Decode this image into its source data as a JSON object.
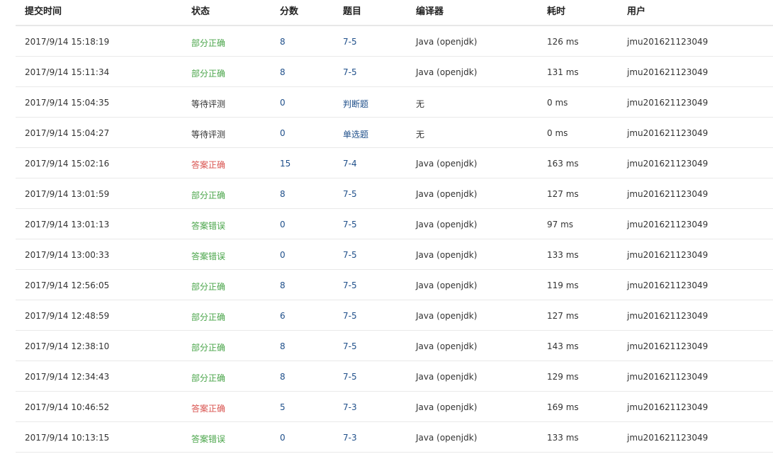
{
  "table": {
    "headers": {
      "time": "提交时间",
      "status": "状态",
      "score": "分数",
      "problem": "题目",
      "compiler": "编译器",
      "timecost": "耗时",
      "user": "用户"
    },
    "status_colors": {
      "partial": "#4aa54a",
      "accepted": "#d9534f",
      "wrong": "#4aa54a",
      "pending": "#333333"
    },
    "rows": [
      {
        "time": "2017/9/14 15:18:19",
        "status": "部分正确",
        "status_type": "partial",
        "score": "8",
        "problem": "7-5",
        "compiler": "Java (openjdk)",
        "timecost": "126 ms",
        "user": "jmu201621123049"
      },
      {
        "time": "2017/9/14 15:11:34",
        "status": "部分正确",
        "status_type": "partial",
        "score": "8",
        "problem": "7-5",
        "compiler": "Java (openjdk)",
        "timecost": "131 ms",
        "user": "jmu201621123049"
      },
      {
        "time": "2017/9/14 15:04:35",
        "status": "等待评测",
        "status_type": "pending",
        "score": "0",
        "problem": "判断题",
        "compiler": "无",
        "timecost": "0 ms",
        "user": "jmu201621123049"
      },
      {
        "time": "2017/9/14 15:04:27",
        "status": "等待评测",
        "status_type": "pending",
        "score": "0",
        "problem": "单选题",
        "compiler": "无",
        "timecost": "0 ms",
        "user": "jmu201621123049"
      },
      {
        "time": "2017/9/14 15:02:16",
        "status": "答案正确",
        "status_type": "accepted",
        "score": "15",
        "problem": "7-4",
        "compiler": "Java (openjdk)",
        "timecost": "163 ms",
        "user": "jmu201621123049"
      },
      {
        "time": "2017/9/14 13:01:59",
        "status": "部分正确",
        "status_type": "partial",
        "score": "8",
        "problem": "7-5",
        "compiler": "Java (openjdk)",
        "timecost": "127 ms",
        "user": "jmu201621123049"
      },
      {
        "time": "2017/9/14 13:01:13",
        "status": "答案错误",
        "status_type": "wrong",
        "score": "0",
        "problem": "7-5",
        "compiler": "Java (openjdk)",
        "timecost": "97 ms",
        "user": "jmu201621123049"
      },
      {
        "time": "2017/9/14 13:00:33",
        "status": "答案错误",
        "status_type": "wrong",
        "score": "0",
        "problem": "7-5",
        "compiler": "Java (openjdk)",
        "timecost": "133 ms",
        "user": "jmu201621123049"
      },
      {
        "time": "2017/9/14 12:56:05",
        "status": "部分正确",
        "status_type": "partial",
        "score": "8",
        "problem": "7-5",
        "compiler": "Java (openjdk)",
        "timecost": "119 ms",
        "user": "jmu201621123049"
      },
      {
        "time": "2017/9/14 12:48:59",
        "status": "部分正确",
        "status_type": "partial",
        "score": "6",
        "problem": "7-5",
        "compiler": "Java (openjdk)",
        "timecost": "127 ms",
        "user": "jmu201621123049"
      },
      {
        "time": "2017/9/14 12:38:10",
        "status": "部分正确",
        "status_type": "partial",
        "score": "8",
        "problem": "7-5",
        "compiler": "Java (openjdk)",
        "timecost": "143 ms",
        "user": "jmu201621123049"
      },
      {
        "time": "2017/9/14 12:34:43",
        "status": "部分正确",
        "status_type": "partial",
        "score": "8",
        "problem": "7-5",
        "compiler": "Java (openjdk)",
        "timecost": "129 ms",
        "user": "jmu201621123049"
      },
      {
        "time": "2017/9/14 10:46:52",
        "status": "答案正确",
        "status_type": "accepted",
        "score": "5",
        "problem": "7-3",
        "compiler": "Java (openjdk)",
        "timecost": "169 ms",
        "user": "jmu201621123049"
      },
      {
        "time": "2017/9/14 10:13:15",
        "status": "答案错误",
        "status_type": "wrong",
        "score": "0",
        "problem": "7-3",
        "compiler": "Java (openjdk)",
        "timecost": "133 ms",
        "user": "jmu201621123049"
      }
    ]
  }
}
